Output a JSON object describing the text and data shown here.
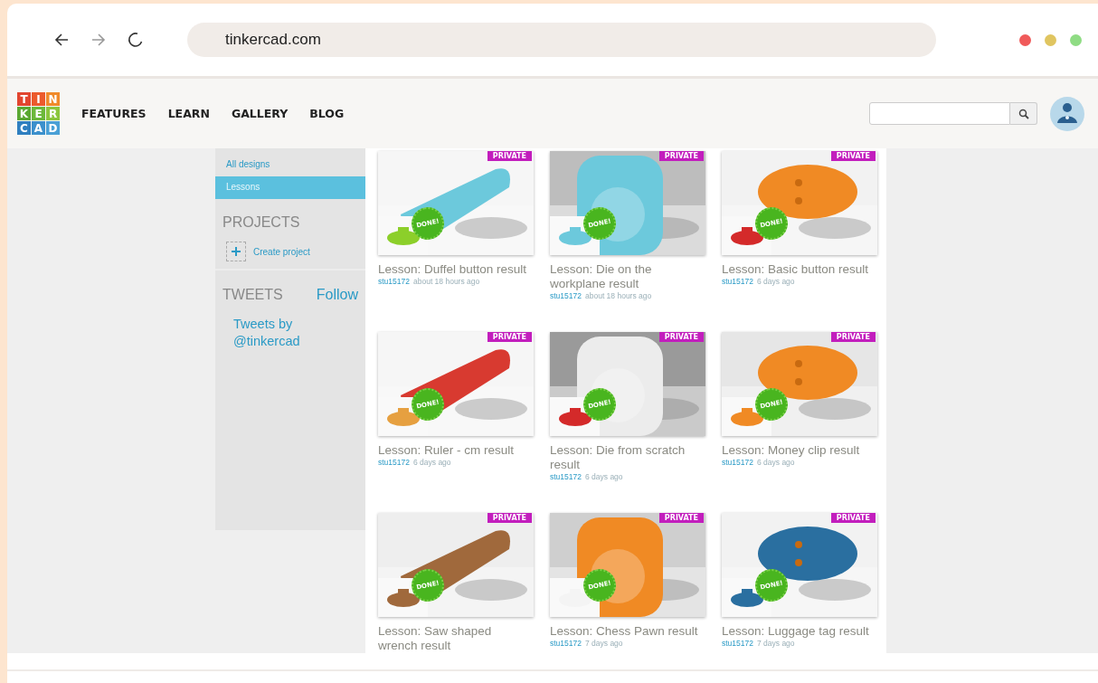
{
  "browser": {
    "address": "tinkercad.com"
  },
  "logo": {
    "letters": [
      {
        "text": "T",
        "color": "#e2452f"
      },
      {
        "text": "I",
        "color": "#ec5a2c"
      },
      {
        "text": "N",
        "color": "#f08a2a"
      },
      {
        "text": "K",
        "color": "#5aa832"
      },
      {
        "text": "E",
        "color": "#6cb83a"
      },
      {
        "text": "R",
        "color": "#8cc63e"
      },
      {
        "text": "C",
        "color": "#2f7fc0"
      },
      {
        "text": "A",
        "color": "#3c90cc"
      },
      {
        "text": "D",
        "color": "#4aa0d6"
      }
    ]
  },
  "nav": [
    "FEATURES",
    "LEARN",
    "GALLERY",
    "BLOG"
  ],
  "sidebar": {
    "items": [
      {
        "label": "All designs",
        "selected": false
      },
      {
        "label": "Lessons",
        "selected": true
      }
    ],
    "projects_heading": "PROJECTS",
    "create_project": "Create project",
    "tweets_heading": "TWEETS",
    "follow": "Follow",
    "tweets_link": "Tweets by @tinkercad"
  },
  "designs": [
    {
      "title": "Lesson: Duffel button result",
      "user": "stu15172",
      "time": "about 18 hours ago",
      "badge": "PRIVATE",
      "status": "DONE!"
    },
    {
      "title": "Lesson: Die on the workplane result",
      "user": "stu15172",
      "time": "about 18 hours ago",
      "badge": "PRIVATE",
      "status": "DONE!"
    },
    {
      "title": "Lesson: Basic button result",
      "user": "stu15172",
      "time": "6 days ago",
      "badge": "PRIVATE",
      "status": "DONE!"
    },
    {
      "title": "Lesson: Ruler - cm result",
      "user": "stu15172",
      "time": "6 days ago",
      "badge": "PRIVATE",
      "status": "DONE!"
    },
    {
      "title": "Lesson: Die from scratch result",
      "user": "stu15172",
      "time": "6 days ago",
      "badge": "PRIVATE",
      "status": "DONE!"
    },
    {
      "title": "Lesson: Money clip result",
      "user": "stu15172",
      "time": "6 days ago",
      "badge": "PRIVATE",
      "status": "DONE!"
    },
    {
      "title": "Lesson: Saw shaped wrench result",
      "badge": "PRIVATE",
      "status": "DONE!"
    },
    {
      "title": "Lesson: Chess Pawn result",
      "user": "stu15172",
      "time": "7 days ago",
      "badge": "PRIVATE",
      "status": "DONE!"
    },
    {
      "title": "Lesson: Luggage tag result",
      "user": "stu15172",
      "time": "7 days ago",
      "badge": "PRIVATE",
      "status": "DONE!"
    }
  ]
}
